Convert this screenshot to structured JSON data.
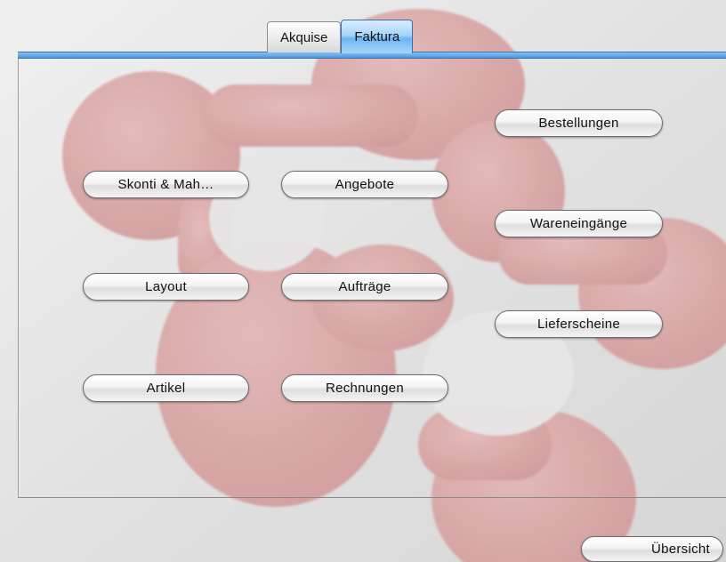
{
  "tabs": [
    {
      "label": "Akquise",
      "active": false
    },
    {
      "label": "Faktura",
      "active": true
    }
  ],
  "buttons": {
    "skonti": "Skonti & Mah…",
    "angebote": "Angebote",
    "layout": "Layout",
    "auftraege": "Aufträge",
    "artikel": "Artikel",
    "rechnungen": "Rechnungen",
    "bestellungen": "Bestellungen",
    "wareneingaenge": "Wareneingänge",
    "lieferscheine": "Lieferscheine",
    "uebersicht": "Übersicht"
  },
  "colors": {
    "accent": "#5a9fe4",
    "background": "#e4e4e4",
    "blob": "#d9a2a2"
  }
}
